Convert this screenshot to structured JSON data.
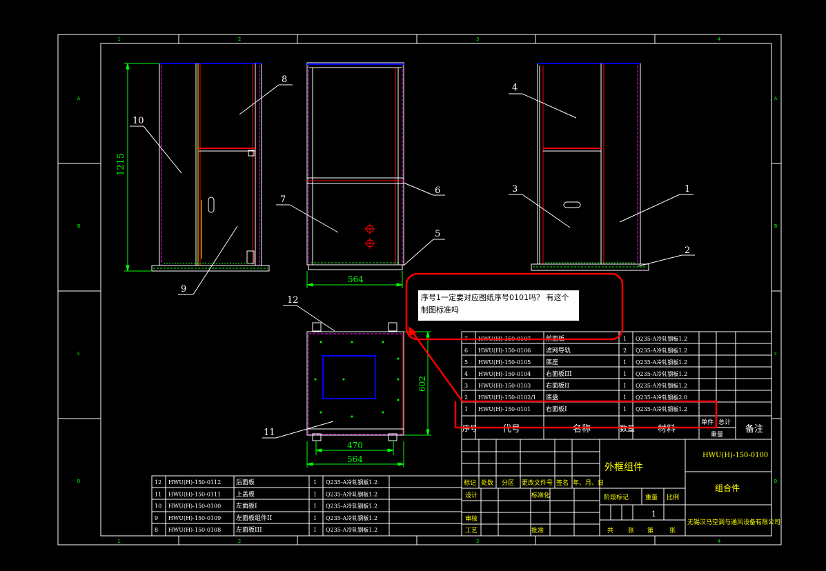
{
  "grid_numbers": [
    "1",
    "2",
    "3",
    "4"
  ],
  "grid_letters": [
    "A",
    "B",
    "C",
    "D"
  ],
  "dims": {
    "height_total": "1215",
    "front_width": "564",
    "top_width": "564",
    "top_inner": "470",
    "top_depth": "602"
  },
  "balloons": [
    "1",
    "2",
    "3",
    "4",
    "5",
    "6",
    "7",
    "8",
    "9",
    "10",
    "11",
    "12"
  ],
  "comment_text": "序号1一定要对应图纸序号0101吗？ 有这个制图标准吗",
  "bom_right": [
    {
      "no": "7",
      "code": "HWU(H)-150-0107",
      "name": "前面板",
      "qty": "1",
      "mat": "Q235-A冷轧钢板1.2"
    },
    {
      "no": "6",
      "code": "HWU(H)-150-0106",
      "name": "滤网导轨",
      "qty": "2",
      "mat": "Q235-A冷轧钢板1.2"
    },
    {
      "no": "5",
      "code": "HWU(H)-150-0105",
      "name": "底座",
      "qty": "1",
      "mat": "Q235-A冷轧钢板1.2"
    },
    {
      "no": "4",
      "code": "HWU(H)-150-0104",
      "name": "右面板III",
      "qty": "1",
      "mat": "Q235-A冷轧钢板1.2"
    },
    {
      "no": "3",
      "code": "HWU(H)-150-0103",
      "name": "右面板II",
      "qty": "1",
      "mat": "Q235-A冷轧钢板1.2"
    },
    {
      "no": "2",
      "code": "HWU(H)-150-0102/1",
      "name": "底盘",
      "qty": "1",
      "mat": "Q235-A冷轧钢板2.0"
    },
    {
      "no": "1",
      "code": "HWU(H)-150-0101",
      "name": "右面板I",
      "qty": "1",
      "mat": "Q235-A冷轧钢板1.2"
    }
  ],
  "bom_header": {
    "no": "序号",
    "code": "代号",
    "name": "名称",
    "qty": "数量",
    "mat": "材料",
    "unit": "单件",
    "total": "总计",
    "weight": "重量",
    "remark": "备注"
  },
  "bom_left": [
    {
      "no": "12",
      "code": "HWU(H)-150-0112",
      "name": "后面板",
      "qty": "1",
      "mat": "Q235-A冷轧钢板1.2"
    },
    {
      "no": "11",
      "code": "HWU(H)-150-0111",
      "name": "上盖板",
      "qty": "1",
      "mat": "Q235-A冷轧钢板1.2"
    },
    {
      "no": "10",
      "code": "HWU(H)-150-0100",
      "name": "左面板I",
      "qty": "1",
      "mat": "Q235-A冷轧钢板1.2"
    },
    {
      "no": "9",
      "code": "HWU(H)-150-0109",
      "name": "左面板组件II",
      "qty": "1",
      "mat": "Q235-A冷轧钢板1.2"
    },
    {
      "no": "8",
      "code": "HWU(H)-150-0108",
      "name": "左面板III",
      "qty": "1",
      "mat": "Q235-A冷轧钢板1.2"
    }
  ],
  "title_block": {
    "title": "外框组件",
    "drawing_no": "HWU(H)-150-0100",
    "type": "组合件",
    "company": "无锡汉马空调与通风设备有限公司",
    "rev_labels": [
      "标记",
      "处数",
      "分区",
      "更改文件号",
      "签名",
      "年、月、日"
    ],
    "design": "设计",
    "standard": "标准化",
    "check": "审核",
    "process": "工艺",
    "approve": "批准",
    "stage_labels": [
      "阶段标记",
      "重量",
      "比例"
    ],
    "qty_value": "1",
    "sheet_labels": [
      "共",
      "张",
      "第",
      "张"
    ]
  }
}
